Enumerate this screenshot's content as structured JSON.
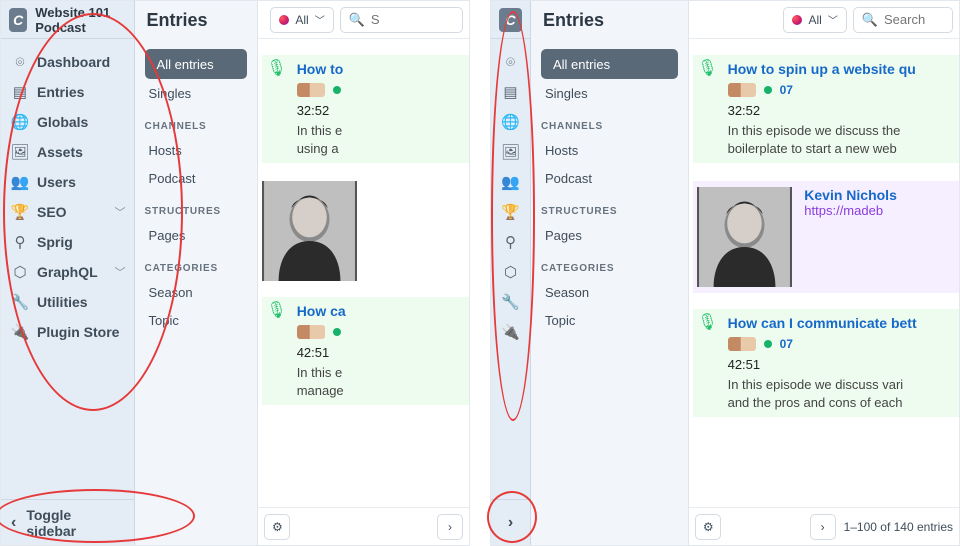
{
  "site_title": "Website 101 Podcast",
  "logo_letter": "C",
  "sidebar": {
    "items": [
      {
        "icon": "⌾",
        "label": "Dashboard",
        "chev": false
      },
      {
        "icon": "▤",
        "label": "Entries",
        "chev": false
      },
      {
        "icon": "🌐",
        "label": "Globals",
        "chev": false
      },
      {
        "icon": "🖼",
        "label": "Assets",
        "chev": false
      },
      {
        "icon": "👥",
        "label": "Users",
        "chev": false
      },
      {
        "icon": "🏆",
        "label": "SEO",
        "chev": true
      },
      {
        "icon": "⚲",
        "label": "Sprig",
        "chev": false
      },
      {
        "icon": "⬡",
        "label": "GraphQL",
        "chev": true
      },
      {
        "icon": "🔧",
        "label": "Utilities",
        "chev": false
      },
      {
        "icon": "🔌",
        "label": "Plugin Store",
        "chev": false
      }
    ],
    "toggle_label": "Toggle sidebar"
  },
  "subnav": {
    "heading": "Entries",
    "active": "All entries",
    "links": [
      {
        "type": "pill",
        "label": "All entries"
      },
      {
        "type": "link",
        "label": "Singles"
      },
      {
        "type": "head",
        "label": "CHANNELS"
      },
      {
        "type": "link",
        "label": "Hosts"
      },
      {
        "type": "link",
        "label": "Podcast"
      },
      {
        "type": "head",
        "label": "STRUCTURES"
      },
      {
        "type": "link",
        "label": "Pages"
      },
      {
        "type": "head",
        "label": "CATEGORIES"
      },
      {
        "type": "link",
        "label": "Season"
      },
      {
        "type": "link",
        "label": "Topic"
      }
    ]
  },
  "topbar": {
    "filter_label": "All",
    "search_placeholder": "Search",
    "search_short": "S"
  },
  "entries_left": {
    "e0": {
      "title": "How to",
      "num": "",
      "dur": "32:52",
      "desc1": "In this e",
      "desc2": "using a"
    },
    "e1": {
      "title": "How ca",
      "num": "",
      "dur": "42:51",
      "desc1": "In this e",
      "desc2": "manage"
    }
  },
  "entries_right": {
    "e0": {
      "title": "How to spin up a website qu",
      "num": "07",
      "dur": "32:52",
      "desc1": "In this episode we discuss the",
      "desc2": "boilerplate to start a new web"
    },
    "guest": {
      "name": "Kevin Nichols",
      "url": "https://madeb"
    },
    "e1": {
      "title": "How can I communicate bett",
      "num": "07",
      "dur": "42:51",
      "desc1": "In this episode we discuss vari",
      "desc2": "and the pros and cons of each"
    }
  },
  "pager": {
    "range": "1–100 of 140 entries"
  }
}
